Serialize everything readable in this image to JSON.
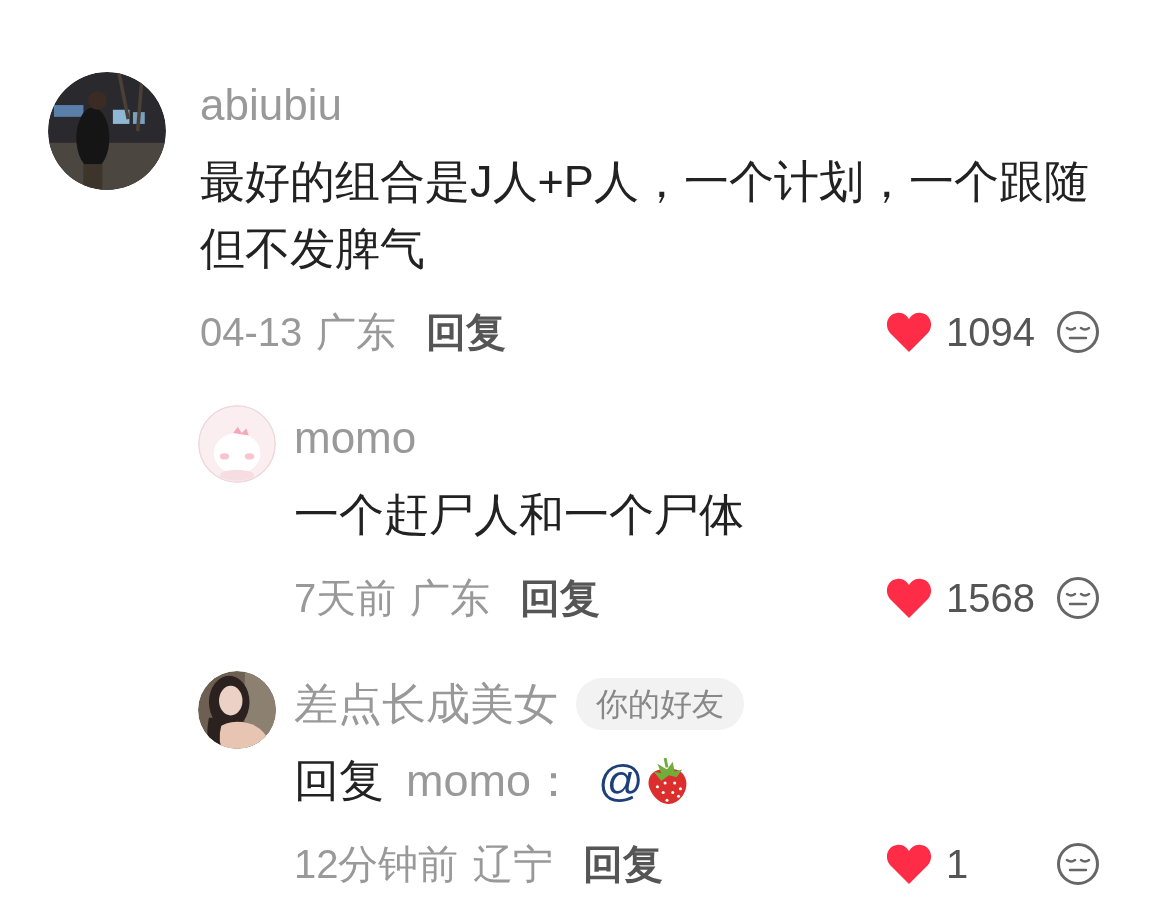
{
  "comments": [
    {
      "name": "abiubiu",
      "text": "最好的组合是J人+P人，一个计划，一个跟随但不发脾气",
      "time": "04-13",
      "location": "广东",
      "reply_label": "回复",
      "likes": "1094",
      "liked": true,
      "replies": [
        {
          "name": "momo",
          "text": "一个赶尸人和一个尸体",
          "time": "7天前",
          "location": "广东",
          "reply_label": "回复",
          "likes": "1568",
          "liked": true
        },
        {
          "name": "差点长成美女",
          "badge": "你的好友",
          "reply_prefix": "回复",
          "reply_to": "momo：",
          "mention": "@",
          "time": "12分钟前",
          "location": "辽宁",
          "reply_label": "回复",
          "likes": "1",
          "liked": true
        }
      ]
    }
  ]
}
